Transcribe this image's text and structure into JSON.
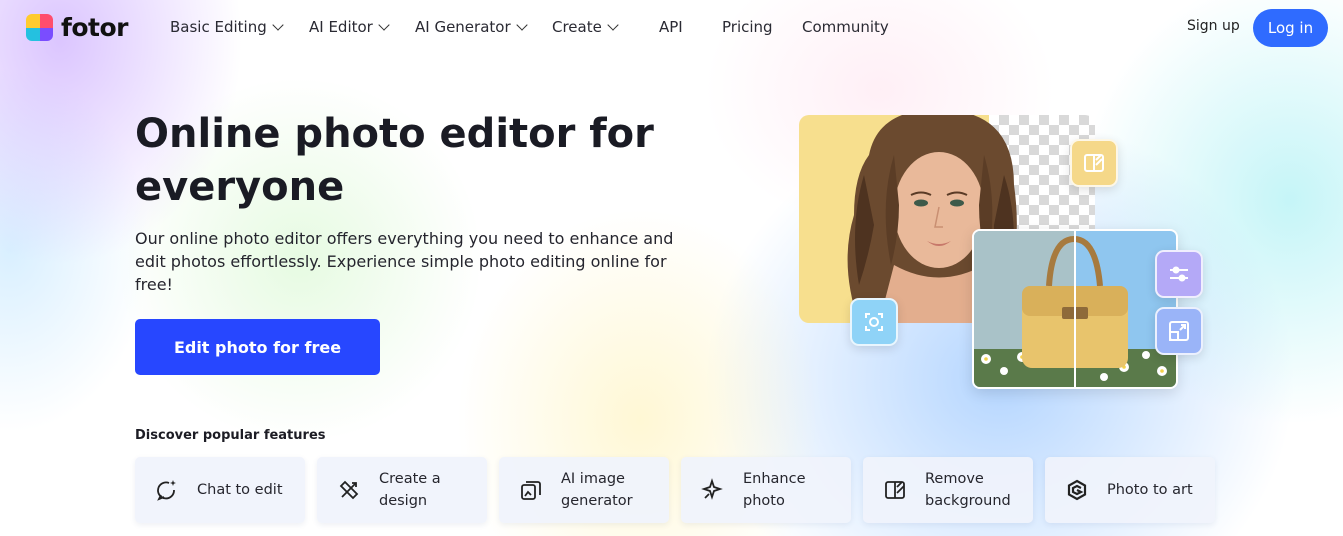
{
  "header": {
    "logo_text": "fotor",
    "nav": [
      {
        "label": "Basic Editing",
        "has_dropdown": true
      },
      {
        "label": "AI Editor",
        "has_dropdown": true
      },
      {
        "label": "AI Generator",
        "has_dropdown": true
      },
      {
        "label": "Create",
        "has_dropdown": true
      },
      {
        "label": "API",
        "has_dropdown": false
      },
      {
        "label": "Pricing",
        "has_dropdown": false
      },
      {
        "label": "Community",
        "has_dropdown": false
      }
    ],
    "signup_label": "Sign up",
    "login_label": "Log in"
  },
  "hero": {
    "title": "Online photo editor for everyone",
    "description": "Our online photo editor offers everything you need to enhance and edit photos effortlessly. Experience simple photo editing online for free!",
    "cta_label": "Edit photo for free"
  },
  "features": {
    "heading": "Discover popular features",
    "items": [
      {
        "label": "Chat to edit",
        "icon": "chat-sparkle-icon"
      },
      {
        "label": "Create a design",
        "icon": "design-tools-icon"
      },
      {
        "label": "AI image generator",
        "icon": "ai-image-icon"
      },
      {
        "label": "Enhance photo",
        "icon": "enhance-sparkle-icon"
      },
      {
        "label": "Remove background",
        "icon": "remove-background-icon"
      },
      {
        "label": "Photo to art",
        "icon": "photo-to-art-icon"
      }
    ]
  },
  "colors": {
    "primary_cta": "#2747ff",
    "login_button": "#2f6bff",
    "chip_yellow": "#f5d889",
    "chip_blue": "#8fd3f7",
    "chip_purple": "#b4a9f7"
  }
}
